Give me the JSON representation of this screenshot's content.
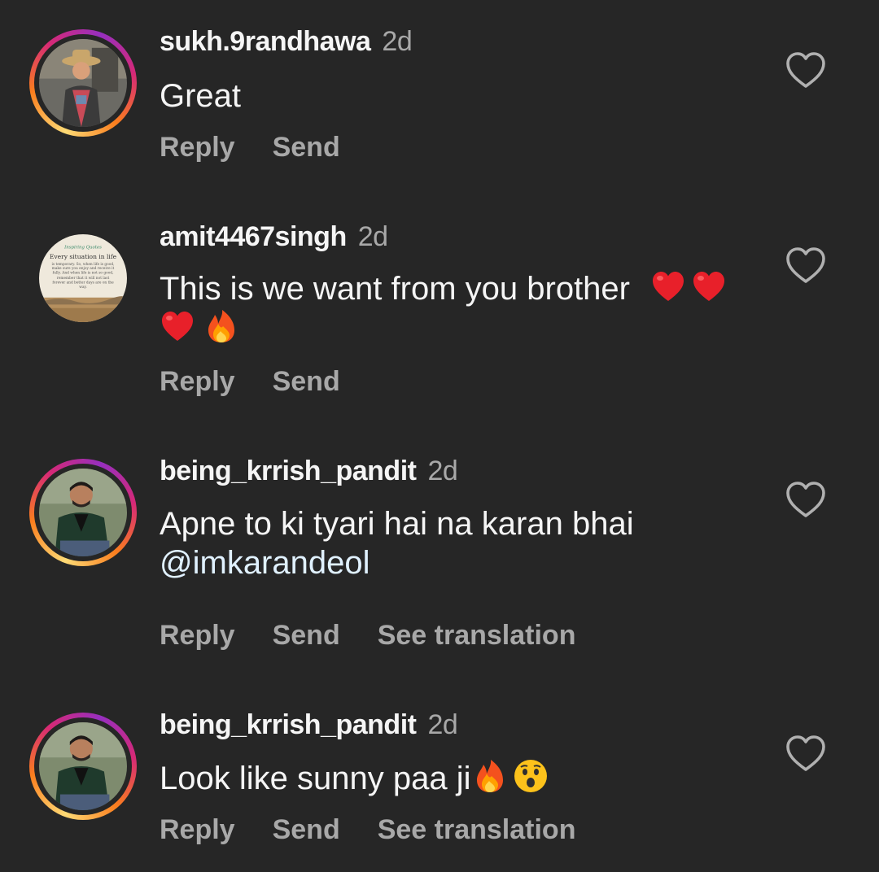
{
  "comments": [
    {
      "username": "sukh.9randhawa",
      "time": "2d",
      "text": "Great",
      "reply": "Reply",
      "send": "Send"
    },
    {
      "username": "amit4467singh",
      "time": "2d",
      "text": "This is we want from you brother",
      "emojis": [
        "red-heart",
        "red-heart",
        "red-heart",
        "fire"
      ],
      "avatar_text": "Every situation in life",
      "avatar_sub": "is temporary. So, when life is good, make sure you enjoy and receive it fully. And when life is not so good, remember that it will not last forever and better days are on the way.",
      "reply": "Reply",
      "send": "Send"
    },
    {
      "username": "being_krrish_pandit",
      "time": "2d",
      "text": "Apne to ki tyari hai na karan bhai",
      "mention": "@imkarandeol",
      "reply": "Reply",
      "send": "Send",
      "translate": "See translation"
    },
    {
      "username": "being_krrish_pandit",
      "time": "2d",
      "text": "Look like sunny paa ji",
      "emojis": [
        "fire",
        "astonished-face"
      ],
      "reply": "Reply",
      "send": "Send",
      "translate": "See translation"
    }
  ],
  "icons": {
    "like": "heart-outline-icon"
  },
  "colors": {
    "background": "#262626",
    "primary_text": "#f5f5f5",
    "secondary_text": "#a8a8a8",
    "mention": "#e0f1ff",
    "heart_emoji": "#e8202a"
  }
}
